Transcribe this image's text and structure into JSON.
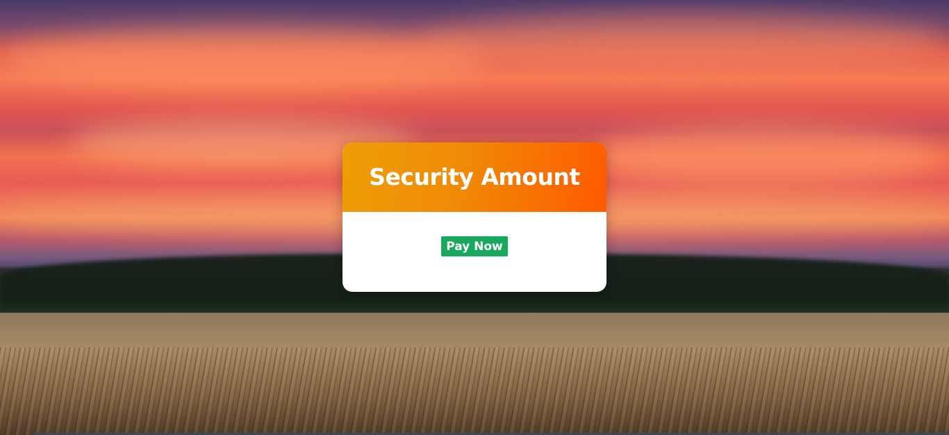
{
  "card": {
    "title": "Security Amount",
    "pay_button_label": "Pay Now"
  },
  "colors": {
    "header_gradient_start": "#ee9e06",
    "header_gradient_end": "#ff5a00",
    "pay_button": "#18a95e",
    "card_body": "#ffffff"
  }
}
